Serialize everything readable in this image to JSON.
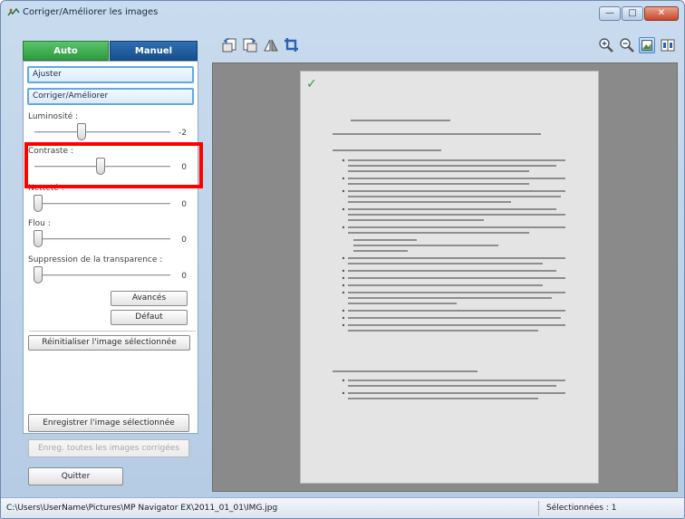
{
  "window": {
    "title": "Corriger/Améliorer les images",
    "controls": {
      "minimize": "—",
      "maximize": "□",
      "close": "✕"
    }
  },
  "tabs": {
    "auto": "Auto",
    "manual": "Manuel"
  },
  "sections": {
    "adjust": "Ajuster",
    "correct": "Corriger/Améliorer"
  },
  "sliders": [
    {
      "label": "Luminosité :",
      "value": "-2"
    },
    {
      "label": "Contraste :",
      "value": "0"
    },
    {
      "label": "Netteté :",
      "value": "0"
    },
    {
      "label": "Flou :",
      "value": "0"
    },
    {
      "label": "Suppression de la transparence :",
      "value": "0"
    }
  ],
  "buttons": {
    "advanced": "Avancés",
    "default": "Défaut",
    "reset_selected": "Réinitialiser l'image sélectionnée",
    "save_selected": "Enregistrer l'image sélectionnée",
    "save_all": "Enreg. toutes les images corrigées",
    "quit": "Quitter"
  },
  "toolbar": {
    "left": [
      "rotate-left-icon",
      "rotate-right-icon",
      "mirror-icon",
      "crop-icon"
    ],
    "right": [
      "zoom-in-icon",
      "zoom-out-icon",
      "full-image-view-icon",
      "compare-view-icon"
    ]
  },
  "status": {
    "path": "C:\\Users\\UserName\\Pictures\\MP Navigator EX\\2011_01_01\\IMG.jpg",
    "selected": "Sélectionnées : 1"
  },
  "colors": {
    "auto_tab": "#3fae50",
    "manual_tab": "#1d5a9a",
    "highlight": "#ff0000",
    "preview_bg": "#8a8a8a"
  }
}
